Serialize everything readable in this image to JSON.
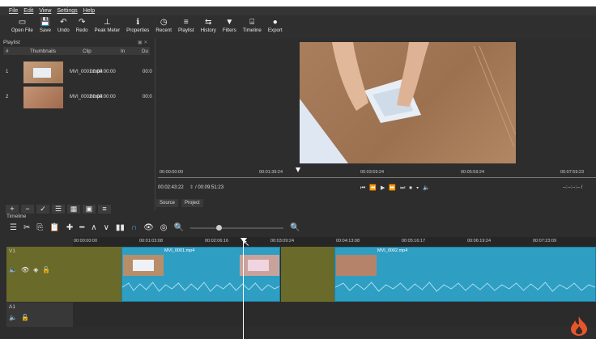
{
  "menu": [
    "File",
    "Edit",
    "View",
    "Settings",
    "Help"
  ],
  "toolbar": [
    {
      "icon": "▭",
      "label": "Open File",
      "name": "open-file"
    },
    {
      "icon": "💾",
      "label": "Save",
      "name": "save"
    },
    {
      "icon": "↶",
      "label": "Undo",
      "name": "undo"
    },
    {
      "icon": "↷",
      "label": "Redo",
      "name": "redo"
    },
    {
      "icon": "⊥",
      "label": "Peak Meter",
      "name": "peak-meter"
    },
    {
      "icon": "ℹ",
      "label": "Properties",
      "name": "properties"
    },
    {
      "icon": "◷",
      "label": "Recent",
      "name": "recent"
    },
    {
      "icon": "≡",
      "label": "Playlist",
      "name": "playlist"
    },
    {
      "icon": "⇆",
      "label": "History",
      "name": "history"
    },
    {
      "icon": "▼",
      "label": "Filters",
      "name": "filters"
    },
    {
      "icon": "⌸",
      "label": "Timeline",
      "name": "timeline"
    },
    {
      "icon": "●",
      "label": "Export",
      "name": "export"
    }
  ],
  "playlist": {
    "title": "Playlist",
    "columns": {
      "num": "#",
      "thumb": "Thumbnails",
      "clip": "Clip",
      "in": "In",
      "du": "Du"
    },
    "rows": [
      {
        "num": "1",
        "clip": "MVI_0001.mp4",
        "in": "00:00:00:00",
        "du": "00:0"
      },
      {
        "num": "2",
        "clip": "MVI_0002.mp4",
        "in": "00:00:00:00",
        "du": "00:0"
      }
    ]
  },
  "player": {
    "ruler_labels": [
      "00:00:00:00",
      "00:01:39:24",
      "00:03:59:24",
      "00:05:59:24",
      "00:07:59:23"
    ],
    "position": "00:02:43:22",
    "duration": "/ 00:09:51:23",
    "in_out": "--:--:--:-- /",
    "tabs": [
      "Source",
      "Project"
    ]
  },
  "timeline": {
    "title": "Timeline",
    "ruler_labels": [
      "00:00:00:00",
      "00:01:03:08",
      "00:02:06:16",
      "00:03:09:24",
      "00:04:13:08",
      "00:05:16:17",
      "00:06:19:24",
      "00:07:23:09"
    ],
    "tracks": {
      "v1": "V1",
      "a1": "A1"
    },
    "clips": [
      "MVI_0001.mp4",
      "MVI_0002.mp4"
    ]
  }
}
